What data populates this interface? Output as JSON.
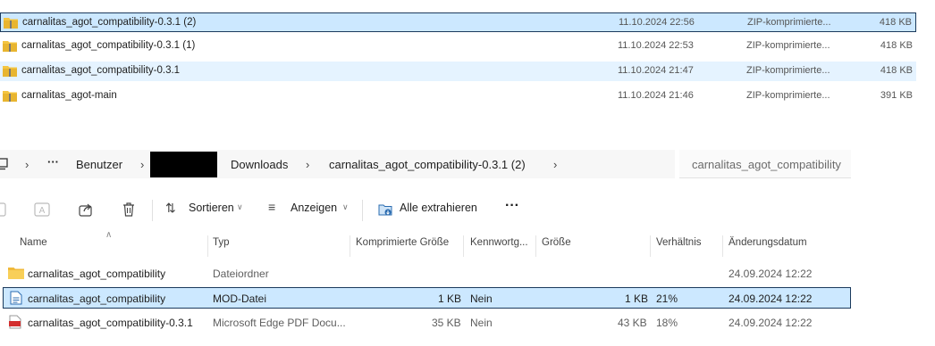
{
  "top_files": [
    {
      "name": "carnalitas_agot_compatibility-0.3.1 (2)",
      "date": "11.10.2024 22:56",
      "type": "ZIP-komprimierte...",
      "size": "418 KB"
    },
    {
      "name": "carnalitas_agot_compatibility-0.3.1 (1)",
      "date": "11.10.2024 22:53",
      "type": "ZIP-komprimierte...",
      "size": "418 KB"
    },
    {
      "name": "carnalitas_agot_compatibility-0.3.1",
      "date": "11.10.2024 21:47",
      "type": "ZIP-komprimierte...",
      "size": "418 KB"
    },
    {
      "name": "carnalitas_agot-main",
      "date": "11.10.2024 21:46",
      "type": "ZIP-komprimierte...",
      "size": "391 KB"
    }
  ],
  "breadcrumb": {
    "more": "···",
    "users": "Benutzer",
    "downloads": "Downloads",
    "archive": "carnalitas_agot_compatibility-0.3.1 (2)"
  },
  "search": {
    "placeholder": "carnalitas_agot_compatibility"
  },
  "toolbar": {
    "sort": "Sortieren",
    "view": "Anzeigen",
    "extract": "Alle extrahieren",
    "more": "···"
  },
  "columns": {
    "name": "Name",
    "type": "Typ",
    "compressed": "Komprimierte Größe",
    "password": "Kennwortg...",
    "size": "Größe",
    "ratio": "Verhältnis",
    "modified": "Änderungsdatum"
  },
  "entries": [
    {
      "name": "carnalitas_agot_compatibility",
      "type": "Dateiordner",
      "compressed": "",
      "password": "",
      "size": "",
      "ratio": "",
      "modified": "24.09.2024 12:22"
    },
    {
      "name": "carnalitas_agot_compatibility",
      "type": "MOD-Datei",
      "compressed": "1 KB",
      "password": "Nein",
      "size": "1 KB",
      "ratio": "21%",
      "modified": "24.09.2024 12:22"
    },
    {
      "name": "carnalitas_agot_compatibility-0.3.1",
      "type": "Microsoft Edge PDF Docu...",
      "compressed": "35 KB",
      "password": "Nein",
      "size": "43 KB",
      "ratio": "18%",
      "modified": "24.09.2024 12:22"
    }
  ],
  "colors": {
    "selection": "#cce8ff",
    "hover": "#e5f3ff",
    "folder": "#f4c542",
    "pdf": "#d32f2f"
  }
}
